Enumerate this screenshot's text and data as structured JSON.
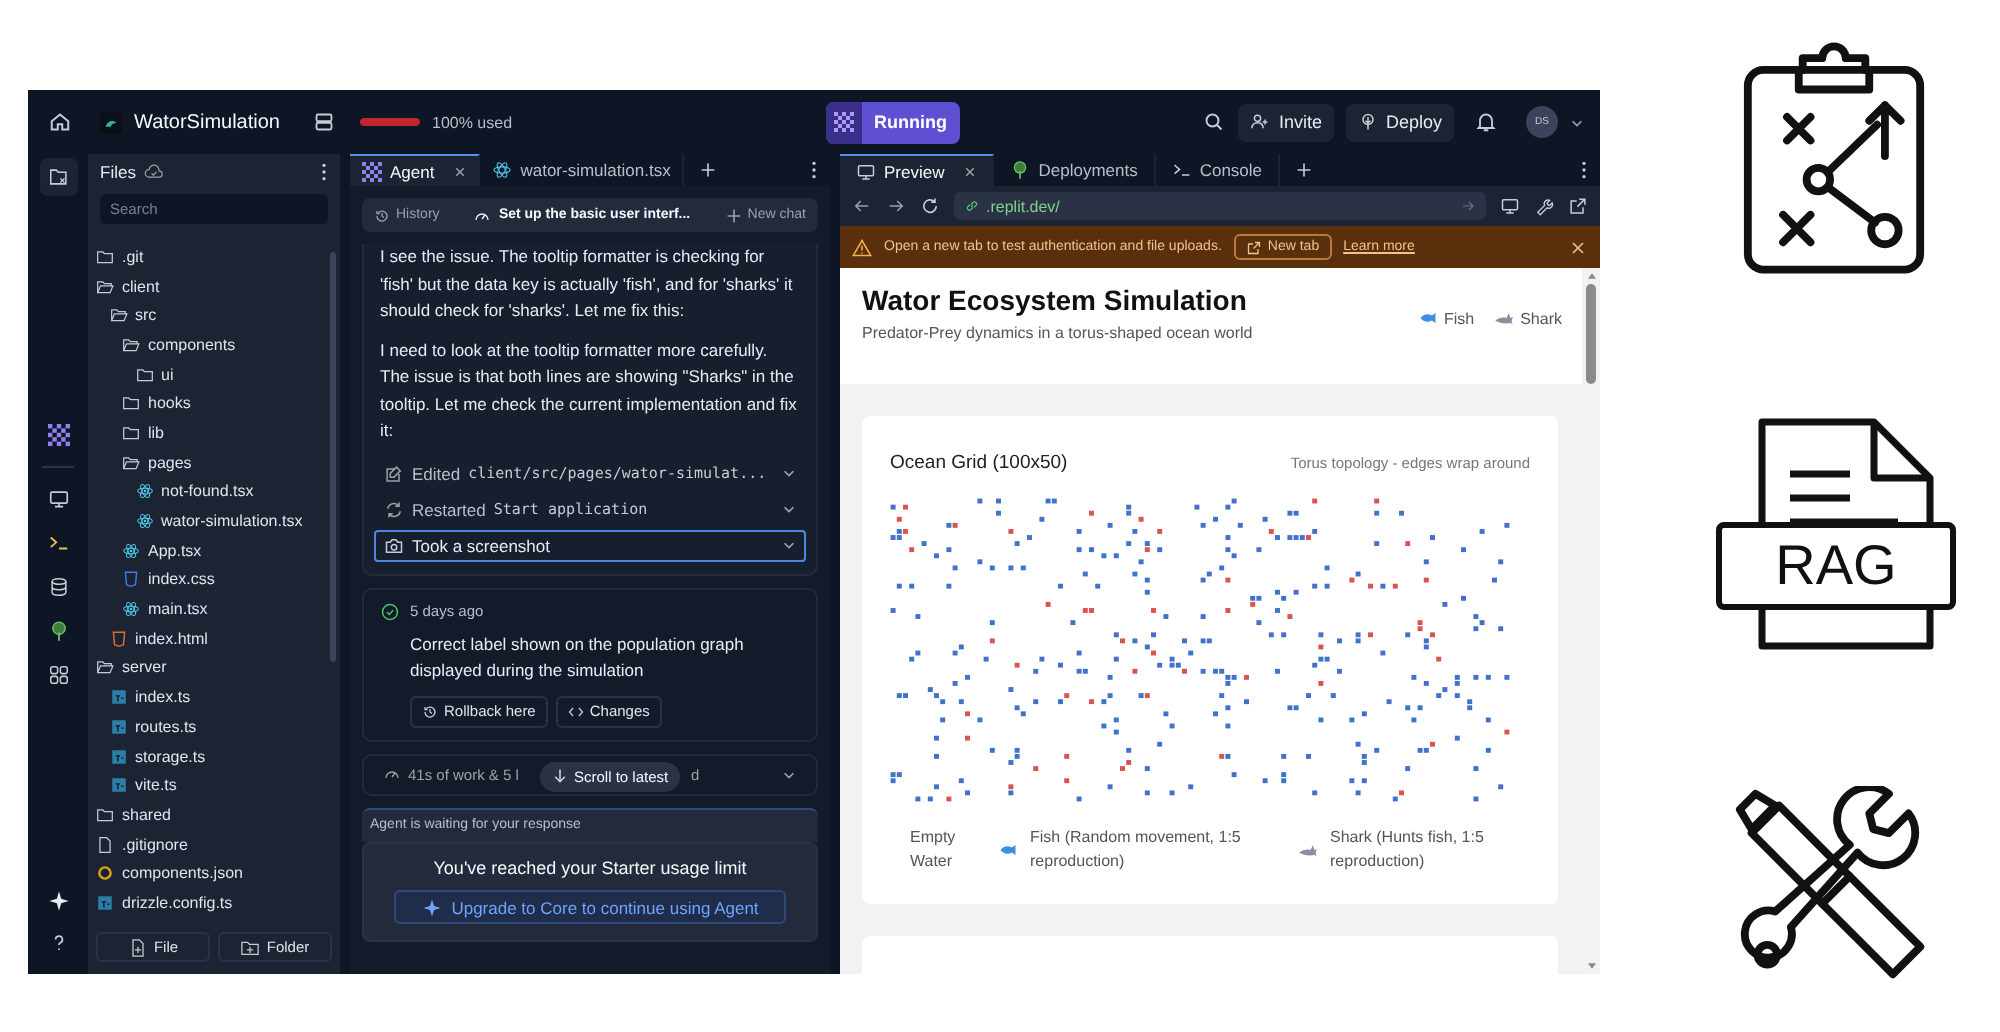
{
  "top_bar": {
    "project_name": "WatorSimulation",
    "usage": {
      "level": 1,
      "label": "100% used"
    },
    "run_button": "Running",
    "invite_button": "Invite",
    "deploy_button": "Deploy",
    "avatar": "DS"
  },
  "files": {
    "title": "Files",
    "search": {
      "placeholder": "Search"
    },
    "tree": [
      {
        "name": ".git",
        "kind": "folder",
        "expanded": false
      },
      {
        "name": "client",
        "kind": "folder",
        "expanded": true,
        "children": [
          {
            "name": "src",
            "kind": "folder",
            "expanded": true,
            "children": [
              {
                "name": "components",
                "kind": "folder",
                "expanded": true,
                "children": [
                  {
                    "name": "ui",
                    "kind": "folder",
                    "expanded": false
                  }
                ]
              },
              {
                "name": "hooks",
                "kind": "folder",
                "expanded": false
              },
              {
                "name": "lib",
                "kind": "folder",
                "expanded": false
              },
              {
                "name": "pages",
                "kind": "folder",
                "expanded": true,
                "children": [
                  {
                    "name": "not-found.tsx",
                    "kind": "react"
                  },
                  {
                    "name": "wator-simulation.tsx",
                    "kind": "react"
                  }
                ]
              },
              {
                "name": "App.tsx",
                "kind": "react"
              },
              {
                "name": "index.css",
                "kind": "css"
              },
              {
                "name": "main.tsx",
                "kind": "react"
              }
            ]
          },
          {
            "name": "index.html",
            "kind": "html"
          }
        ]
      },
      {
        "name": "server",
        "kind": "folder",
        "expanded": true,
        "children": [
          {
            "name": "index.ts",
            "kind": "ts"
          },
          {
            "name": "routes.ts",
            "kind": "ts"
          },
          {
            "name": "storage.ts",
            "kind": "ts"
          },
          {
            "name": "vite.ts",
            "kind": "ts"
          }
        ]
      },
      {
        "name": "shared",
        "kind": "folder",
        "expanded": false
      },
      {
        "name": ".gitignore",
        "kind": "file"
      },
      {
        "name": "components.json",
        "kind": "json"
      },
      {
        "name": "drizzle.config.ts",
        "kind": "ts"
      }
    ],
    "new_file_button": "File",
    "new_folder_button": "Folder"
  },
  "agent": {
    "tabs": [
      {
        "label": "Agent",
        "kind": "agent",
        "selected": true,
        "closable": true
      },
      {
        "label": "wator-simulation.tsx",
        "kind": "react",
        "selected": false,
        "closable": false
      }
    ],
    "history_button": "History",
    "chat_title": "Set up the basic user interf...",
    "new_chat_button": "New chat",
    "messages": [
      "I see the issue. The tooltip formatter is checking for 'fish' but the data key is actually 'fish', and for 'sharks' it should check for 'sharks'. Let me fix this:",
      "I need to look at the tooltip formatter more carefully. The issue is that both lines are showing \"Sharks\" in the tooltip. Let me check the current implementation and fix it:"
    ],
    "actions": [
      {
        "kind": "edit",
        "verb": "Edited",
        "target": "client/src/pages/wator-simulat...",
        "selected": false
      },
      {
        "kind": "restart",
        "verb": "Restarted",
        "target": "Start application",
        "selected": false
      },
      {
        "kind": "screenshot",
        "verb": "Took a screenshot",
        "selected": true
      }
    ],
    "checkpoint": {
      "time": "5 days ago",
      "text": "Correct label shown on the population graph displayed during the simulation",
      "rollback_button": "Rollback here",
      "changes_button": "Changes"
    },
    "work_summary": [
      "41s of work & 5 l",
      "d"
    ],
    "scroll_button": "Scroll to latest",
    "waiting": "Agent is waiting for your response",
    "limit": {
      "message": "You've reached your Starter usage limit",
      "upgrade_button": "Upgrade to Core to continue using Agent"
    }
  },
  "preview": {
    "tabs": [
      {
        "label": "Preview",
        "kind": "preview",
        "selected": true,
        "closable": true
      },
      {
        "label": "Deployments",
        "kind": "deploy",
        "selected": false,
        "closable": false
      },
      {
        "label": "Console",
        "kind": "console",
        "selected": false,
        "closable": false
      }
    ],
    "url": ".replit.dev/",
    "banner": {
      "message": "Open a new tab to test authentication and file uploads.",
      "new_tab_button": "New tab",
      "learn_more": "Learn more"
    },
    "app": {
      "title": "Wator Ecosystem Simulation",
      "subtitle": "Predator-Prey dynamics in a torus-shaped ocean world",
      "legend_top": [
        {
          "kind": "fish",
          "label": "Fish"
        },
        {
          "kind": "shark",
          "label": "Shark"
        }
      ],
      "grid_card": {
        "title": "Ocean Grid (100x50)",
        "note": "Torus topology - edges wrap around",
        "legend": [
          {
            "kind": "empty",
            "label": "Empty Water"
          },
          {
            "kind": "fish",
            "label": "Fish (Random movement, 1:5 reproduction)"
          },
          {
            "kind": "shark",
            "label": "Shark (Hunts fish, 1:5 reproduction)"
          }
        ]
      }
    }
  },
  "side_art": {
    "rag_label": "RAG"
  }
}
